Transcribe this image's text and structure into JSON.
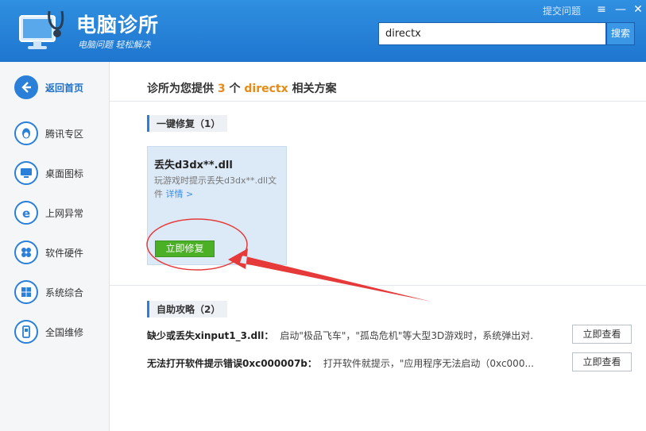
{
  "header": {
    "app_title": "电脑诊所",
    "app_subtitle": "电脑问题 轻松解决",
    "report_link": "提交问题",
    "search_value": "directx",
    "search_button": "搜索",
    "icons": [
      "monitor-stethoscope-icon",
      "menu-icon",
      "minimize-icon",
      "close-icon"
    ]
  },
  "sidebar": {
    "items": [
      {
        "label": "返回首页",
        "icon": "back-arrow-icon"
      },
      {
        "label": "腾讯专区",
        "icon": "qq-penguin-icon"
      },
      {
        "label": "桌面图标",
        "icon": "monitor-icon"
      },
      {
        "label": "上网异常",
        "icon": "ie-browser-icon"
      },
      {
        "label": "软件硬件",
        "icon": "puzzle-icon"
      },
      {
        "label": "系统综合",
        "icon": "windows-icon"
      },
      {
        "label": "全国维修",
        "icon": "phone-icon"
      }
    ]
  },
  "main": {
    "title_prefix": "诊所为您提供",
    "count": "3",
    "title_mid": "个",
    "keyword": "directx",
    "title_suffix": "相关方案",
    "one_click": {
      "section_label": "一键修复（1）",
      "card_title": "丢失d3dx**.dll",
      "card_desc": "玩游戏时提示丢失d3dx**.dll文件",
      "card_link": "详情 >",
      "fix_button": "立即修复"
    },
    "self_help": {
      "section_label": "自助攻略（2）",
      "rows": [
        {
          "title": "缺少或丢失xinput1_3.dll：",
          "desc": "启动\"极品飞车\"，\"孤岛危机\"等大型3D游戏时，系统弹出对...",
          "button": "立即查看"
        },
        {
          "title": "无法打开软件提示错误0xc000007b：",
          "desc": "打开软件就提示，\"应用程序无法启动（0xc000...",
          "button": "立即查看"
        }
      ]
    }
  },
  "colors": {
    "header_blue": "#2384d8",
    "accent_orange": "#e58b16",
    "fix_green": "#4bb026",
    "annotation_red": "#e63a3a"
  }
}
